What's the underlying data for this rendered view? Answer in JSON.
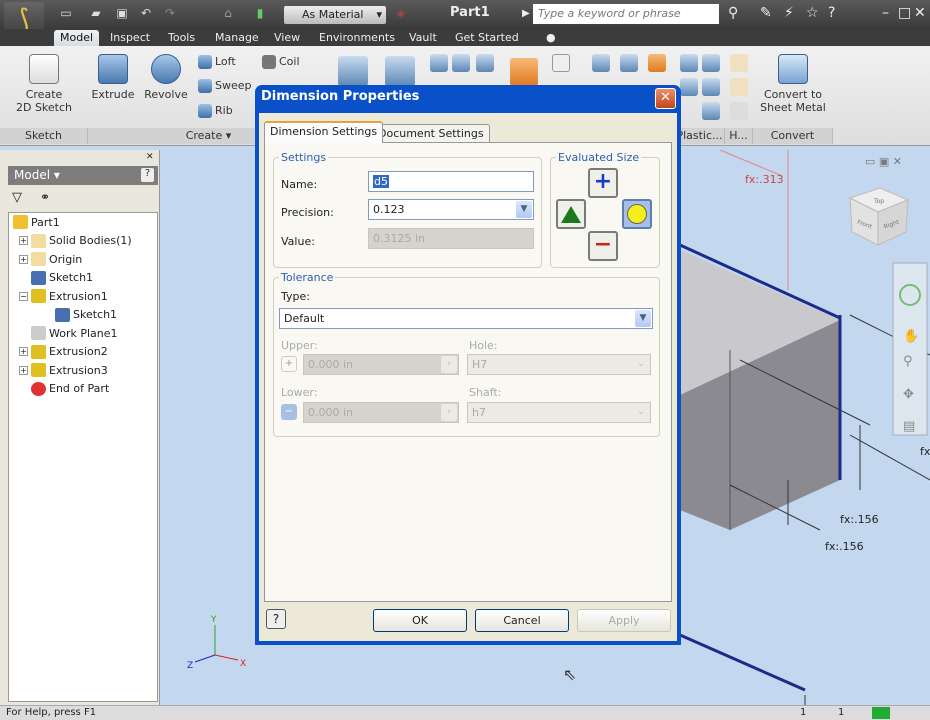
{
  "app": {
    "title": "Part1",
    "material": "As Material",
    "search_placeholder": "Type a keyword or phrase",
    "window_controls": [
      "minimize",
      "maximize",
      "close"
    ]
  },
  "tabs": [
    "Model",
    "Inspect",
    "Tools",
    "Manage",
    "View",
    "Environments",
    "Vault",
    "Get Started"
  ],
  "ribbon": {
    "sketch": {
      "create_2d_sketch": "Create\n2D Sketch",
      "panel": "Sketch"
    },
    "create": {
      "extrude": "Extrude",
      "revolve": "Revolve",
      "loft": "Loft",
      "sweep": "Sweep",
      "rib": "Rib",
      "coil": "Coil",
      "panel": "Create"
    },
    "plastic_panel": "Plastic...",
    "harness_panel": "H...",
    "convert": {
      "button": "Convert to\nSheet Metal",
      "panel": "Convert"
    }
  },
  "browser": {
    "title": "Model",
    "items": [
      {
        "label": "Part1",
        "level": 0,
        "icon": "part-icon"
      },
      {
        "label": "Solid Bodies(1)",
        "level": 1,
        "icon": "folder-icon"
      },
      {
        "label": "Origin",
        "level": 1,
        "icon": "folder-icon"
      },
      {
        "label": "Sketch1",
        "level": 1,
        "icon": "sketch-icon"
      },
      {
        "label": "Extrusion1",
        "level": 1,
        "icon": "extrusion-icon"
      },
      {
        "label": "Sketch1",
        "level": 2,
        "icon": "sketch-icon"
      },
      {
        "label": "Work Plane1",
        "level": 1,
        "icon": "workplane-icon"
      },
      {
        "label": "Extrusion2",
        "level": 1,
        "icon": "extrusion-icon"
      },
      {
        "label": "Extrusion3",
        "level": 1,
        "icon": "extrusion-icon"
      },
      {
        "label": "End of Part",
        "level": 1,
        "icon": "end-of-part-icon"
      }
    ]
  },
  "viewport": {
    "dims": [
      "fx:.313",
      "fx:.156",
      "fx:.156",
      "fx"
    ],
    "viewcube": [
      "Top",
      "Front",
      "Right"
    ]
  },
  "dialog": {
    "title": "Dimension Properties",
    "tabs": [
      "Dimension Settings",
      "Document Settings"
    ],
    "settings": {
      "legend": "Settings",
      "name_label": "Name:",
      "name_value": "d5",
      "precision_label": "Precision:",
      "precision_value": "0.123",
      "value_label": "Value:",
      "value_value": "0.3125 in"
    },
    "evaluated_size": {
      "legend": "Evaluated Size",
      "selected": "nominal"
    },
    "tolerance": {
      "legend": "Tolerance",
      "type_label": "Type:",
      "type_value": "Default",
      "upper_label": "Upper:",
      "upper_value": "0.000 in",
      "lower_label": "Lower:",
      "lower_value": "0.000 in",
      "hole_label": "Hole:",
      "hole_value": "H7",
      "shaft_label": "Shaft:",
      "shaft_value": "h7"
    },
    "buttons": {
      "ok": "OK",
      "cancel": "Cancel",
      "apply": "Apply"
    }
  },
  "status": {
    "help": "For Help, press F1",
    "counts": [
      "1",
      "1"
    ]
  }
}
